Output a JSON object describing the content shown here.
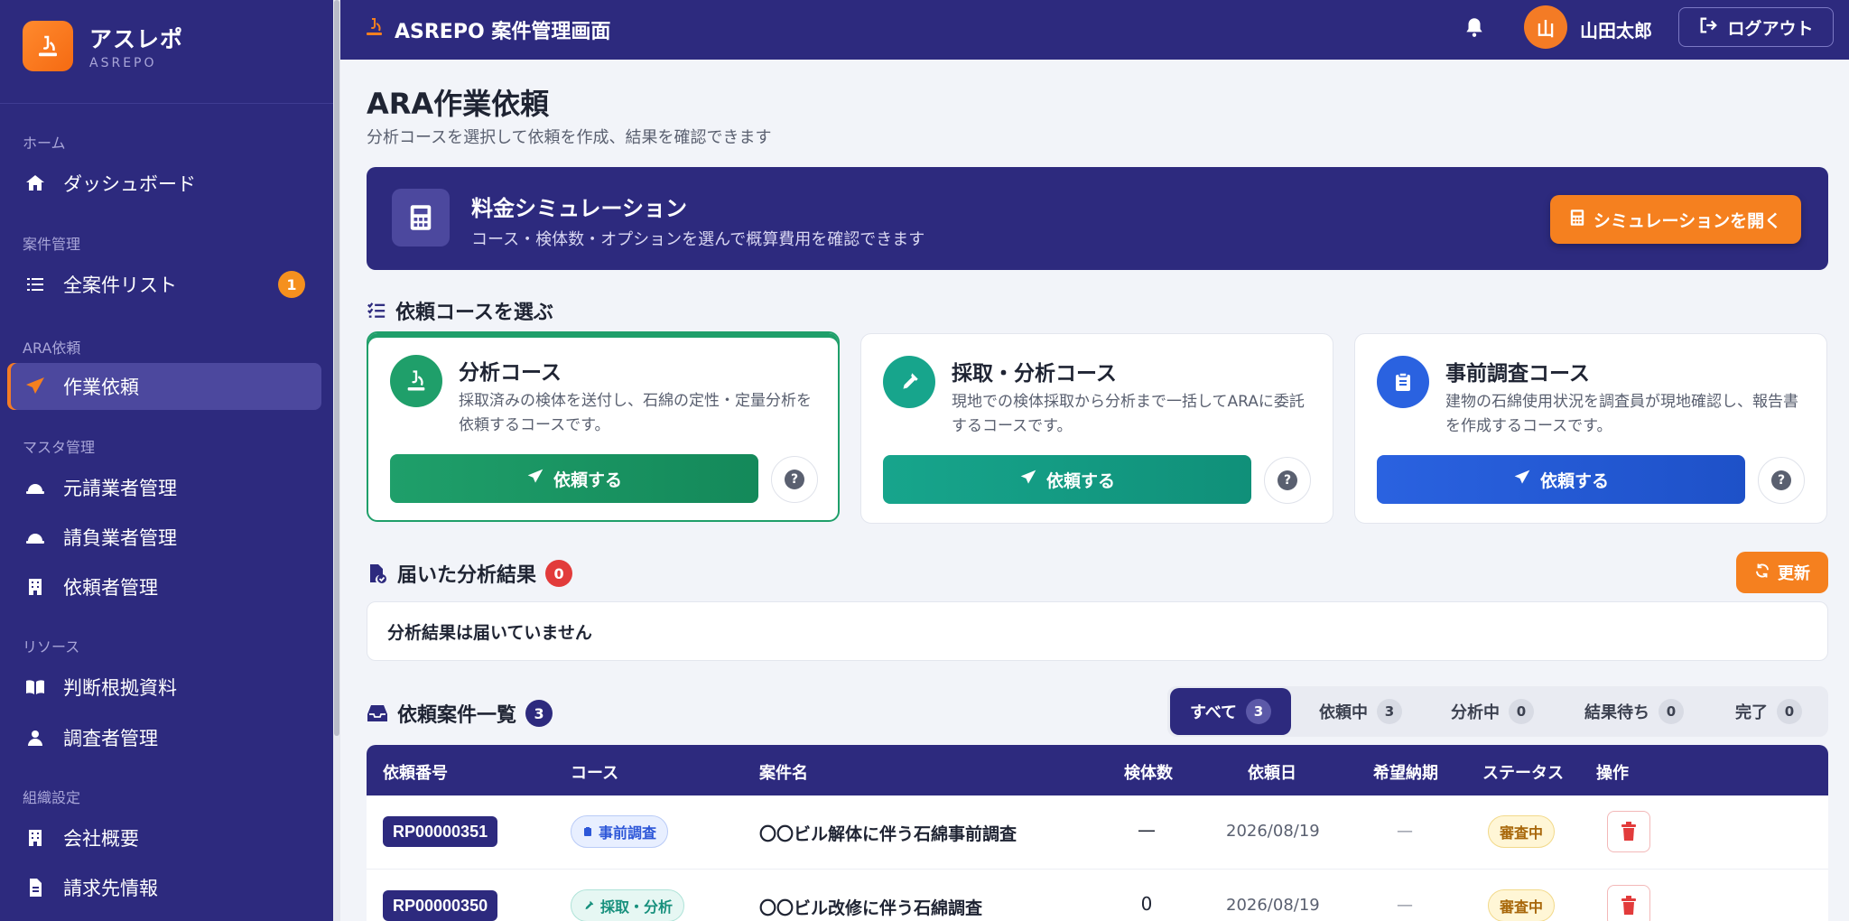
{
  "brand": {
    "name": "アスレポ",
    "sub": "ASREPO"
  },
  "sidebar": {
    "sections": [
      "ホーム",
      "案件管理",
      "ARA依頼",
      "マスタ管理",
      "リソース",
      "組織設定"
    ],
    "items": [
      {
        "label": "ダッシュボード",
        "icon": "home-icon"
      },
      {
        "label": "全案件リスト",
        "icon": "list-icon",
        "badge": "1"
      },
      {
        "label": "作業依頼",
        "icon": "paper-plane-icon",
        "active": true
      },
      {
        "label": "元請業者管理",
        "icon": "hardhat-icon"
      },
      {
        "label": "請負業者管理",
        "icon": "hardhat-icon"
      },
      {
        "label": "依頼者管理",
        "icon": "building-icon"
      },
      {
        "label": "判断根拠資料",
        "icon": "book-icon"
      },
      {
        "label": "調査者管理",
        "icon": "user-icon"
      },
      {
        "label": "会社概要",
        "icon": "building-icon"
      },
      {
        "label": "請求先情報",
        "icon": "invoice-icon"
      }
    ]
  },
  "header": {
    "title": "ASREPO 案件管理画面",
    "avatar_initial": "山",
    "user_name": "山田太郎",
    "logout_label": "ログアウト"
  },
  "page": {
    "title": "ARA作業依頼",
    "subtitle": "分析コースを選択して依頼を作成、結果を確認できます"
  },
  "simulation": {
    "title": "料金シミュレーション",
    "subtitle": "コース・検体数・オプションを選んで概算費用を確認できます",
    "button": "シミュレーションを開く"
  },
  "courses": {
    "heading": "依頼コースを選ぶ",
    "items": [
      {
        "title": "分析コース",
        "desc": "採取済みの検体を送付し、石綿の定性・定量分析を依頼するコースです。",
        "button": "依頼する",
        "color": "#1f9f6a",
        "icon": "microscope-icon"
      },
      {
        "title": "採取・分析コース",
        "desc": "現地での検体採取から分析まで一括してARAに委託するコースです。",
        "button": "依頼する",
        "color": "#17a58c",
        "icon": "dropper-icon"
      },
      {
        "title": "事前調査コース",
        "desc": "建物の石綿使用状況を調査員が現地確認し、報告書を作成するコースです。",
        "button": "依頼する",
        "color": "#2a62e0",
        "icon": "clipboard-icon"
      }
    ],
    "help": "?"
  },
  "results": {
    "heading": "届いた分析結果",
    "count": "0",
    "refresh": "更新",
    "empty": "分析結果は届いていません"
  },
  "requests": {
    "heading": "依頼案件一覧",
    "count": "3",
    "tabs": [
      {
        "label": "すべて",
        "count": "3",
        "active": true
      },
      {
        "label": "依頼中",
        "count": "3"
      },
      {
        "label": "分析中",
        "count": "0"
      },
      {
        "label": "結果待ち",
        "count": "0"
      },
      {
        "label": "完了",
        "count": "0"
      }
    ],
    "columns": [
      "依頼番号",
      "コース",
      "案件名",
      "検体数",
      "依頼日",
      "希望納期",
      "ステータス",
      "操作"
    ],
    "rows": [
      {
        "id": "RP00000351",
        "course": "事前調査",
        "name": "〇〇ビル解体に伴う石綿事前調査",
        "samples": "—",
        "date": "2026/08/19",
        "due": "—",
        "status": "審査中"
      },
      {
        "id": "RP00000350",
        "course": "採取・分析",
        "name": "〇〇ビル改修に伴う石綿調査",
        "samples": "0",
        "date": "2026/08/19",
        "due": "—",
        "status": "審査中"
      }
    ]
  },
  "colors": {
    "primary": "#2d2a7e",
    "accent": "#f5801f",
    "danger": "#e23b3b"
  }
}
